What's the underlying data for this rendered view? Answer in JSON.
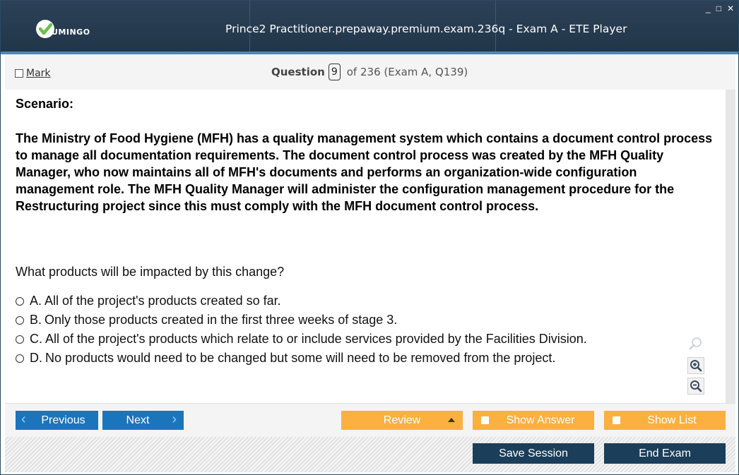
{
  "window": {
    "title": "Prince2 Practitioner.prepaway.premium.exam.236q - Exam A - ETE Player",
    "brand": "UMINGO",
    "controls": [
      "_",
      "□",
      "✕"
    ]
  },
  "question_bar": {
    "mark_label": "Mark",
    "question_label": "Question",
    "question_number": "9",
    "question_of": "of 236 (Exam A, Q139)"
  },
  "content": {
    "scenario_heading": "Scenario:",
    "scenario_text": "The Ministry of Food Hygiene (MFH) has a quality management system which contains a document control process to manage all documentation requirements. The document control process was created by the MFH Quality Manager, who now maintains all of MFH's documents and performs an organization-wide configuration management role. The MFH Quality Manager will administer the configuration management procedure for the Restructuring project since this must comply with the MFH document control process.",
    "question": "What products will be impacted by this change?",
    "options": [
      {
        "letter": "A.",
        "text": "All of the project's products created so far."
      },
      {
        "letter": "B.",
        "text": "Only those products created in the first three weeks of stage 3."
      },
      {
        "letter": "C.",
        "text": "All of the project's products which relate to or include services provided by the Facilities Division."
      },
      {
        "letter": "D.",
        "text": "No products would need to be changed but some will need to be removed from the project."
      }
    ]
  },
  "nav": {
    "previous": "Previous",
    "next": "Next",
    "review": "Review",
    "show_answer": "Show Answer",
    "show_list": "Show List",
    "save_session": "Save Session",
    "end_exam": "End Exam"
  },
  "colors": {
    "titlebar": "#22364a",
    "accent_blue": "#1b75bb",
    "accent_orange": "#fbb040",
    "dark_button": "#1b3e5a",
    "logo_green": "#6cc04a"
  },
  "icons": {
    "zoom_fit": "magnifier-icon",
    "zoom_in": "zoom-in-icon",
    "zoom_out": "zoom-out-icon"
  }
}
